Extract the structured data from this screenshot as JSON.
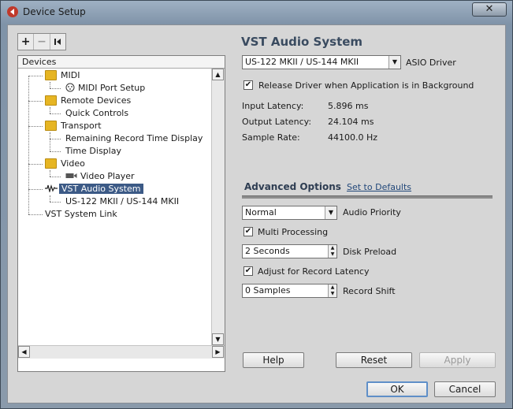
{
  "window": {
    "title": "Device Setup",
    "close_glyph": "✕"
  },
  "toolbar": {
    "add": "+",
    "remove": "−",
    "reset": "|◀"
  },
  "tree": {
    "header": "Devices",
    "items": [
      {
        "label": "MIDI",
        "icon": "folder-icon"
      },
      {
        "label": "MIDI Port Setup",
        "icon": "midi-port-icon"
      },
      {
        "label": "Remote Devices",
        "icon": "folder-icon"
      },
      {
        "label": "Quick Controls",
        "icon": ""
      },
      {
        "label": "Transport",
        "icon": "folder-icon"
      },
      {
        "label": "Remaining Record Time Display",
        "icon": ""
      },
      {
        "label": "Time Display",
        "icon": ""
      },
      {
        "label": "Video",
        "icon": "folder-icon"
      },
      {
        "label": "Video Player",
        "icon": "video-player-icon"
      },
      {
        "label": "VST Audio System",
        "icon": "audio-system-icon",
        "selected": true
      },
      {
        "label": "US-122 MKII / US-144 MKII",
        "icon": ""
      },
      {
        "label": "VST System Link",
        "icon": ""
      }
    ]
  },
  "vst": {
    "title": "VST Audio System",
    "driver_value": "US-122 MKII / US-144 MKII",
    "driver_label": "ASIO Driver",
    "release_label": "Release Driver when Application is in Background",
    "release_checked": true,
    "input_latency_label": "Input Latency:",
    "input_latency_value": "5.896 ms",
    "output_latency_label": "Output Latency:",
    "output_latency_value": "24.104 ms",
    "sample_rate_label": "Sample Rate:",
    "sample_rate_value": "44100.0 Hz"
  },
  "advanced": {
    "tab_label": "Advanced Options",
    "defaults_link": "Set to Defaults",
    "priority_value": "Normal",
    "priority_label": "Audio Priority",
    "multi_label": "Multi Processing",
    "multi_checked": true,
    "preload_value": "2 Seconds",
    "preload_label": "Disk Preload",
    "adjust_label": "Adjust for Record Latency",
    "adjust_checked": true,
    "shift_value": "0 Samples",
    "shift_label": "Record Shift"
  },
  "buttons": {
    "help": "Help",
    "reset": "Reset",
    "apply": "Apply",
    "ok": "OK",
    "cancel": "Cancel"
  },
  "check_glyph": "✔"
}
